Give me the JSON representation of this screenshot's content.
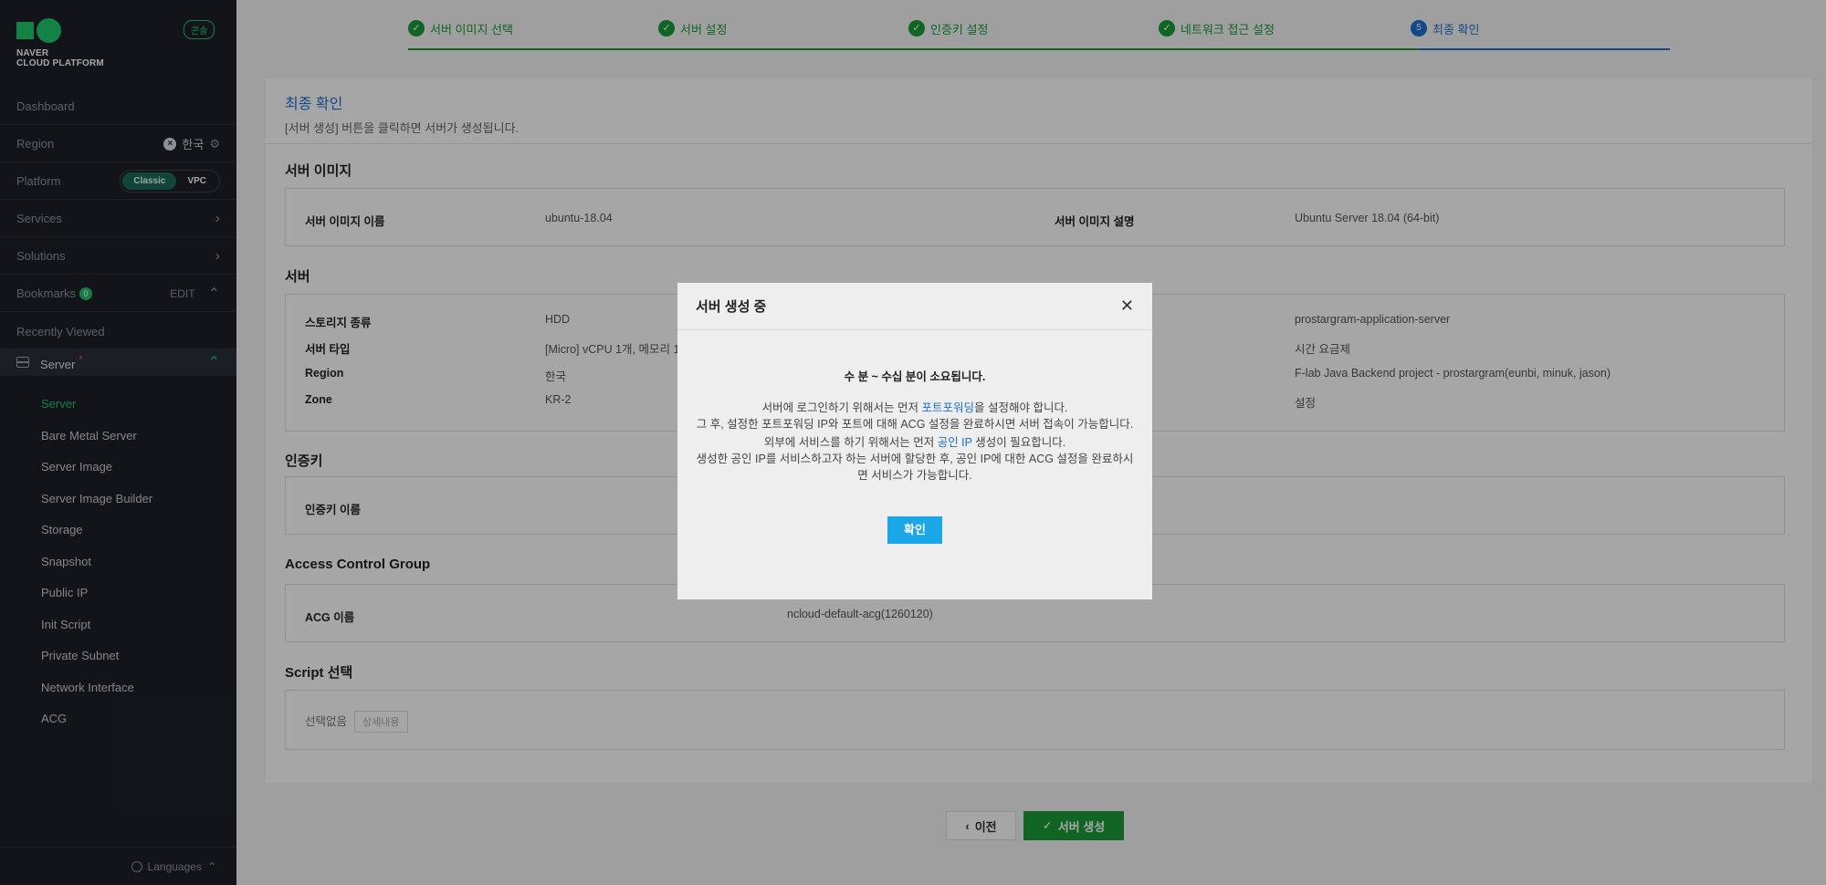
{
  "sidebar": {
    "logo": "NAVER\nCLOUD PLATFORM",
    "logo_line1": "NAVER",
    "logo_line2": "CLOUD PLATFORM",
    "console_badge": "콘솔",
    "dashboard": "Dashboard",
    "region_label": "Region",
    "region_value": "한국",
    "platform_label": "Platform",
    "platform_options": [
      "Classic",
      "VPC"
    ],
    "services": "Services",
    "solutions": "Solutions",
    "bookmarks": "Bookmarks",
    "bookmarks_count": "0",
    "bookmarks_edit": "EDIT",
    "recently_viewed": "Recently Viewed",
    "server_group": "Server",
    "server_items": [
      "Server",
      "Bare Metal Server",
      "Server Image",
      "Server Image Builder",
      "Storage",
      "Snapshot",
      "Public IP",
      "Init Script",
      "Private Subnet",
      "Network Interface",
      "ACG"
    ],
    "languages": "Languages"
  },
  "steps": [
    {
      "label": "서버 이미지 선택",
      "status": "done"
    },
    {
      "label": "서버 설정",
      "status": "done"
    },
    {
      "label": "인증키 설정",
      "status": "done"
    },
    {
      "label": "네트워크 접근 설정",
      "status": "done"
    },
    {
      "label": "최종 확인",
      "status": "current",
      "num": "5"
    }
  ],
  "panel": {
    "title": "최종 확인",
    "desc": "[서버 생성] 버튼을 클릭하면 서버가 생성됩니다.",
    "image_section": "서버 이미지",
    "image_name_label": "서버 이미지 이름",
    "image_name_value": "ubuntu-18.04",
    "image_desc_label": "서버 이미지 설명",
    "image_desc_value": "Ubuntu Server 18.04 (64-bit)",
    "server_section": "서버",
    "storage_label": "스토리지 종류",
    "storage_value": "HDD",
    "type_label": "서버 타입",
    "type_value": "[Micro] vCPU 1개, 메모리 1",
    "region_label": "Region",
    "region_value": "한국",
    "zone_label": "Zone",
    "zone_value": "KR-2",
    "right_values": [
      "prostargram-application-server",
      "시간 요금제",
      "F-lab Java Backend project - prostargram(eunbi, minuk, jason)",
      "설정"
    ],
    "key_section": "인증키",
    "key_name_label": "인증키 이름",
    "acg_section": "Access Control Group",
    "acg_label": "ACG 이름",
    "acg_value": "ncloud-default-acg(1260120)",
    "script_section": "Script 선택",
    "script_value": "선택없음",
    "script_detail": "상세내용"
  },
  "buttons": {
    "prev": "이전",
    "create": "서버 생성"
  },
  "modal": {
    "title": "서버 생성 중",
    "lead": "수 분 ~ 수십 분이 소요됩니다.",
    "p1_pre": "서버에 로그인하기 위해서는 먼저 ",
    "p1_link": "포트포워딩",
    "p1_post": "을 설정해야 합니다.",
    "p2": "그 후, 설정한 포트포워딩 IP와 포트에 대해 ACG 설정을 완료하시면 서버 접속이 가능합니다.",
    "p3_pre": "외부에 서비스를 하기 위해서는 먼저 ",
    "p3_link": "공인 IP",
    "p3_post": " 생성이 필요합니다.",
    "p4": "생성한 공인 IP를 서비스하고자 하는 서버에 할당한 후, 공인 IP에 대한 ACG 설정을 완료하시면 서비스가 가능합니다.",
    "ok": "확인"
  }
}
